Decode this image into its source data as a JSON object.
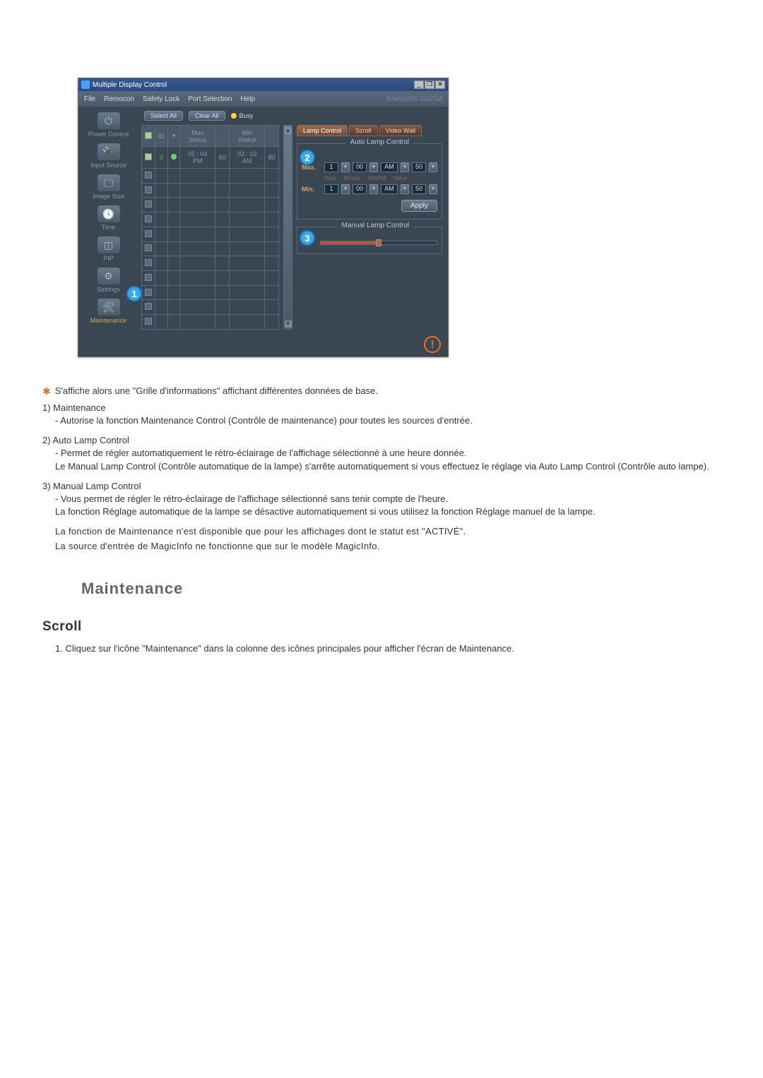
{
  "window": {
    "title": "Multiple Display Control",
    "min": "_",
    "restore": "❐",
    "close": "✕"
  },
  "menubar": {
    "file": "File",
    "remocon": "Remocon",
    "safety_lock": "Safety Lock",
    "port_selection": "Port Selection",
    "help": "Help",
    "brand": "SAMSUNG DIGITall"
  },
  "sidebar": {
    "power": "Power Control",
    "input": "Input Source",
    "image": "Image Size",
    "time": "Time",
    "pip": "PIP",
    "settings": "Settings",
    "maintenance": "Maintenance"
  },
  "toolbar": {
    "select_all": "Select All",
    "clear_all": "Clear All",
    "busy": "Busy"
  },
  "grid": {
    "headers": {
      "check": "",
      "id": "ID",
      "status": "",
      "max": "Max Status",
      "maxv": "",
      "min": "Min Status",
      "minv": ""
    },
    "row0": {
      "id": "0",
      "max": "05 : 04 PM",
      "maxv": "60",
      "min": "03 : 02 AM",
      "minv": "80"
    }
  },
  "tabs": {
    "lamp": "Lamp Control",
    "scroll": "Scroll",
    "video": "Video Wall"
  },
  "auto_lamp": {
    "title": "Auto Lamp Control",
    "max": "Max.",
    "min": "Min.",
    "hour1": "1",
    "minute1": "00",
    "ampm1": "AM",
    "value1": "50",
    "hour2": "1",
    "minute2": "00",
    "ampm2": "AM",
    "value2": "50",
    "l_hour": "Hour",
    "l_minute": "Minute",
    "l_ampm": "AM/PM",
    "l_value": "Value",
    "apply": "Apply"
  },
  "manual_lamp": {
    "title": "Manual Lamp Control",
    "value": "50"
  },
  "callouts": {
    "c1": "1",
    "c2": "2",
    "c3": "3"
  },
  "doc": {
    "star_line": "S'affiche alors une \"Grille d'informations\" affichant différentes données de base.",
    "item1_head": "1)  Maintenance",
    "item1_body": "- Autorise la fonction Maintenance Control (Contrôle de maintenance) pour toutes les sources d'entrée.",
    "item2_head": "2)  Auto Lamp Control",
    "item2_body1": "- Permet de régler automatiquement le rétro-éclairage de l'affichage sélectionné à une heure donnée.",
    "item2_body2": "Le Manual Lamp Control (Contrôle automatique de la lampe) s'arrête automatiquement si vous effectuez le réglage via Auto Lamp Control (Contrôle auto lampe).",
    "item3_head": "3)  Manual Lamp Control",
    "item3_body1": "- Vous permet de régler le rétro-éclairage de l'affichage sélectionné sans tenir compte de l'heure.",
    "item3_body2": "La fonction Réglage automatique de la lampe se désactive automatiquement si vous utilisez la fonction Réglage manuel de la lampe.",
    "emph1": "La fonction de Maintenance n'est disponible que pour les affichages dont le statut est \"ACTIVÉ\".",
    "emph2": "La source d'entrée de MagicInfo ne fonctionne que sur le modèle MagicInfo.",
    "h_maintenance": "Maintenance",
    "h_scroll": "Scroll",
    "step1": "1.  Cliquez sur l'icône \"Maintenance\" dans la colonne des icônes principales pour afficher l'écran de Maintenance."
  }
}
